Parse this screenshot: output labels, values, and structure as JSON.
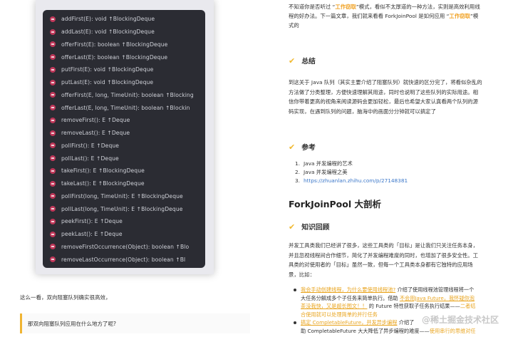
{
  "ide_methods": [
    "addFirst(E): void ↑BlockingDeque",
    "addLast(E): void ↑BlockingDeque",
    "offerFirst(E): boolean ↑BlockingDeque",
    "offerLast(E): boolean ↑BlockingDeque",
    "putFirst(E): void ↑BlockingDeque",
    "putLast(E): void ↑BlockingDeque",
    "offerFirst(E, long, TimeUnit): boolean ↑Blocking",
    "offerLast(E, long, TimeUnit): boolean ↑Blockin",
    "removeFirst(): E ↑Deque",
    "removeLast(): E ↑Deque",
    "pollFirst(): E ↑Deque",
    "pollLast(): E ↑Deque",
    "takeFirst(): E ↑BlockingDeque",
    "takeLast(): E ↑BlockingDeque",
    "pollFirst(long, TimeUnit): E ↑BlockingDeque",
    "pollLast(long, TimeUnit): E ↑BlockingDeque",
    "peekFirst(): E ↑Deque",
    "peekLast(): E ↑Deque",
    "removeFirstOccurrence(Object): boolean ↑Blo",
    "removeLastOccurrence(Object): boolean ↑Bl"
  ],
  "left": {
    "caption": "这么一看，双向阻塞队列确实很高效，",
    "quote": "那双向阻塞队列应用在什么地方了呢?"
  },
  "right": {
    "intro": {
      "line1_a": "不知道你是否听过 “",
      "line1_hl": "工作窃取",
      "line1_b": "”模式，看似不太厚道的一种方法，实则是高效利用线",
      "line2_a": "程的好办法。下一篇文章，我们就来看看 ForkJoinPool 是如何应用 “",
      "line2_hl": "工作窃取",
      "line2_b": "”模",
      "line3": "式的"
    },
    "summary_title": "总结",
    "summary_lines": [
      "到这关于 Java 队列（其实主要介绍了阻塞队列）就快速的区分完了，将看似杂乱的",
      "方法做了分类整理，方便快速理解其用途，同时也说明了这些队列的实际用途。相",
      "信你带着更高的视角来阅读源码会更加轻松，最后也希望大家认真看两个队列的源",
      "码实现，在遇到队列的问题，脑海中的画面分分钟就可以搞定了"
    ],
    "refs_title": "参考",
    "refs": [
      {
        "num": "1.",
        "text": "Java 并发编程的艺术"
      },
      {
        "num": "2.",
        "text": "Java 并发编程之美"
      },
      {
        "num": "3.",
        "text": "https://zhuanlan.zhihu.com/p/27148381"
      }
    ],
    "big_title": "ForkJoinPool 大剖析",
    "knowledge_title": "知识回顾",
    "knowledge_lines": [
      "并发工具类我们已经讲了很多，这些工具类的「目标」是让我们只关注任务本身，",
      "并且忽视线程间合作细节，简化了并发编程难度的同时，也增加了很多安全性。工",
      "具类的对使用者的「目标」虽然一致，但每一个工具类本身都有它独特的应用场",
      "景，比如："
    ],
    "bullet1": {
      "l1_a": "我会手动创建线程，为什么要使用线程池?",
      "l1_b": " 介绍了使用线程池管理线程将一个",
      "l2": "大任务分解成多个子任务来简单执行。借助 ",
      "l2_hl": "不会用Java Future，我怀疑你泡",
      "l3_hl": "茶没我快，又是超长图文！！",
      "l3_b": "  的 Future 特性获取子任务执行结果——",
      "l3_c": "二者结",
      "l4": "合使用就可以处理简单的并行任务"
    },
    "bullet2": {
      "l1_a": "搞定 CompletableFuture，并发异步编程",
      "l1_b": "  介绍了",
      "l2_a": "助 CompletableFuture 大大降低了异步编程的难度——",
      "l2_hl": "使用串行的思维对任"
    },
    "watermark": "@稀土掘金技术社区"
  }
}
